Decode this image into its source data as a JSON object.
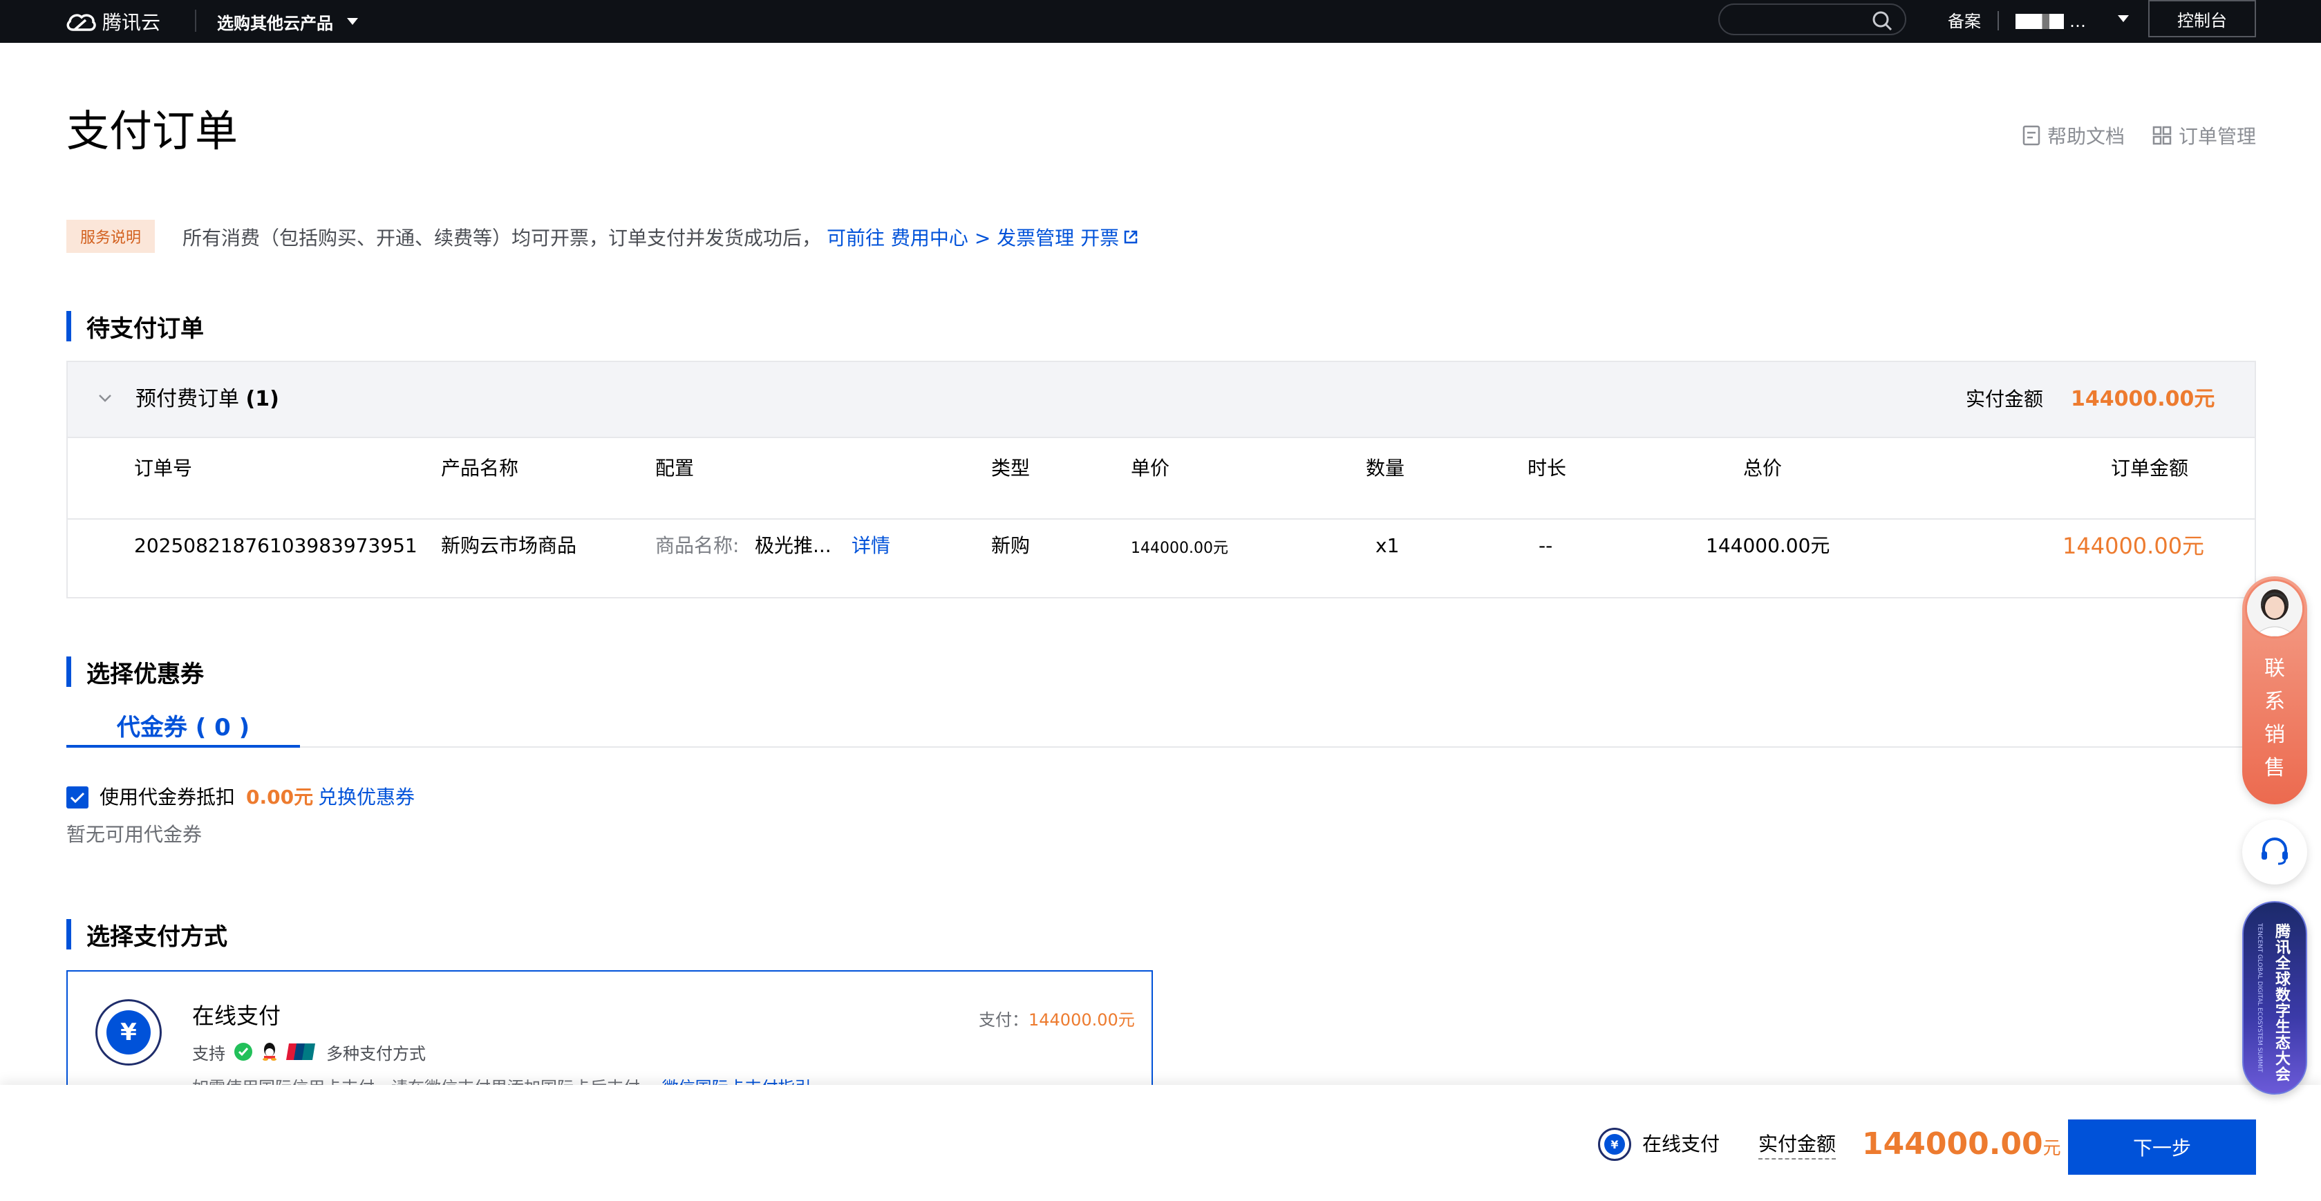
{
  "topbar": {
    "logo_text": "腾讯云",
    "products_menu": "选购其他云产品",
    "search_placeholder": "",
    "beian": "备案",
    "user_name": "…",
    "console": "控制台"
  },
  "header": {
    "title": "支付订单",
    "help_docs": "帮助文档",
    "order_management": "订单管理"
  },
  "notice": {
    "badge": "服务说明",
    "text": "所有消费（包括购买、开通、续费等）均可开票，订单支付并发货成功后，",
    "link": "可前往 费用中心 > 发票管理 开票"
  },
  "pending_orders": {
    "section_title": "待支付订单",
    "group_title": "预付费订单",
    "group_count": "(1)",
    "pay_label": "实付金额",
    "pay_amount": "144000.00元",
    "columns": [
      "订单号",
      "产品名称",
      "配置",
      "类型",
      "单价",
      "数量",
      "时长",
      "总价",
      "订单金额"
    ],
    "rows": [
      {
        "order_no": "20250821876103983973951",
        "product": "新购云市场商品",
        "config_label": "商品名称:",
        "config_value": "极光推...",
        "details": "详情",
        "type": "新购",
        "unit_price": "144000.00元",
        "quantity": "x1",
        "duration": "--",
        "total": "144000.00元",
        "order_amount": "144000.00元"
      }
    ]
  },
  "coupons": {
    "section_title": "选择优惠券",
    "tab_label": "代金券 ( 0 )",
    "use_coupon_label": "使用代金券抵扣",
    "use_coupon_checked": true,
    "coupon_amount": "0.00元",
    "exchange": "兑换优惠券",
    "empty_text": "暂无可用代金券"
  },
  "payment": {
    "section_title": "选择支付方式",
    "method_title": "在线支付",
    "support_label": "支持",
    "multi_methods": "多种支付方式",
    "note": "如需使用国际信用卡支付，请在微信支付里添加国际卡后支付。",
    "note_link": "微信国际卡支付指引",
    "amount_label": "支付：",
    "amount_value": "144000.00元",
    "icon_symbol": "¥"
  },
  "bottom_bar": {
    "method": "在线支付",
    "pay_label": "实付金额",
    "amount": "144000.00",
    "unit": "元",
    "next": "下一步"
  },
  "floating": {
    "sales_chars": [
      "联",
      "系",
      "销",
      "售"
    ],
    "event_text": "腾讯全球数字生态大会",
    "event_sub": "TENCENT GLOBAL DIGITAL ECOSYSTEM SUMMIT"
  },
  "colors": {
    "brand_blue": "#0052d9",
    "accent_orange": "#ed7b2f",
    "topbar_bg": "#0e1116"
  }
}
